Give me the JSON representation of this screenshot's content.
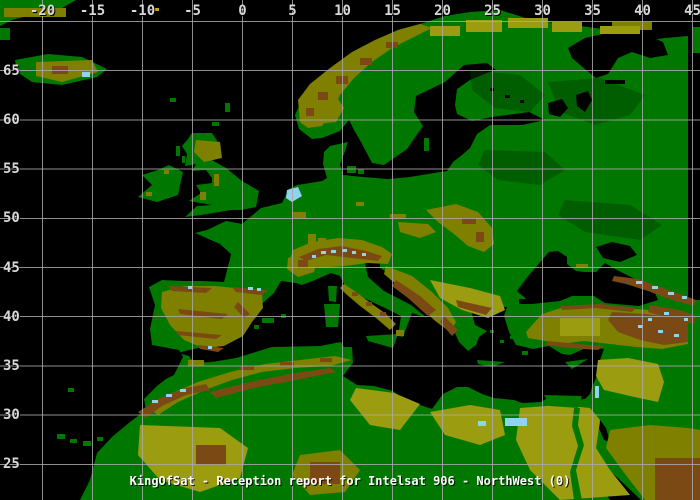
{
  "caption": "KingOfSat - Reception report for Intelsat 906 - NorthWest (0)",
  "axes": {
    "top_longitude_labels": [
      "-20",
      "-15",
      "-10",
      "-5",
      "0",
      "5",
      "10",
      "15",
      "20",
      "25",
      "30",
      "35",
      "40",
      "45"
    ],
    "left_latitude_labels": [
      "65",
      "60",
      "55",
      "50",
      "45",
      "40",
      "35",
      "30",
      "25"
    ]
  },
  "palette": {
    "ocean": "#000000",
    "lowland": "#007800",
    "lowlandShade": "#003c00",
    "upland": "#7f7f00",
    "uplandLight": "#9c9c10",
    "mountain": "#7b4a14",
    "glacier": "#8fd3f0",
    "gridline": "#a9a9a9",
    "axisText": "#d8d8d8",
    "captionText": "#ffffff",
    "marker": "#c8aa00"
  }
}
